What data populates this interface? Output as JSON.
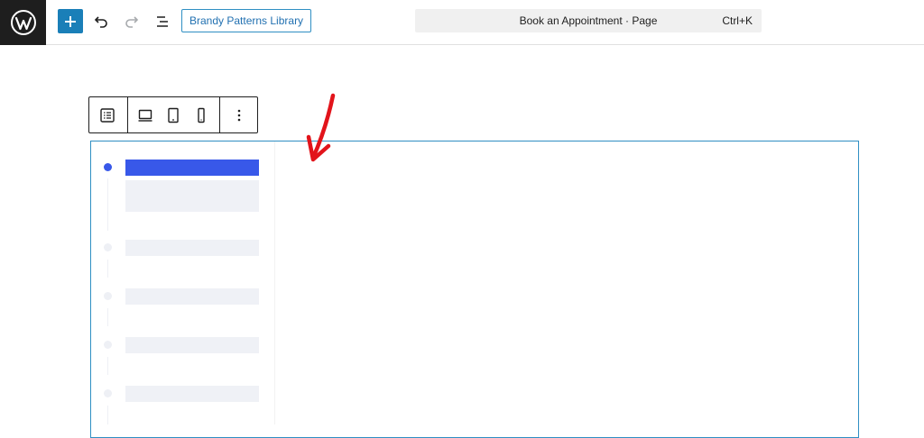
{
  "toolbar": {
    "patterns_label": "Brandy Patterns Library",
    "command_title": "Book an Appointment · Page",
    "command_shortcut": "Ctrl+K"
  },
  "icons": [
    "wordpress-logo-icon",
    "plus-icon",
    "undo-icon",
    "redo-icon",
    "list-view-icon",
    "block-type-icon",
    "desktop-icon",
    "tablet-icon",
    "mobile-icon",
    "more-options-icon",
    "annotation-arrow-icon"
  ],
  "colors": {
    "accent": "#1a7fb8",
    "active_tab": "#3858e9",
    "placeholder": "#eff1f6",
    "annotation": "#e2141b"
  },
  "tabs": {
    "active_index": 0,
    "count": 5
  }
}
